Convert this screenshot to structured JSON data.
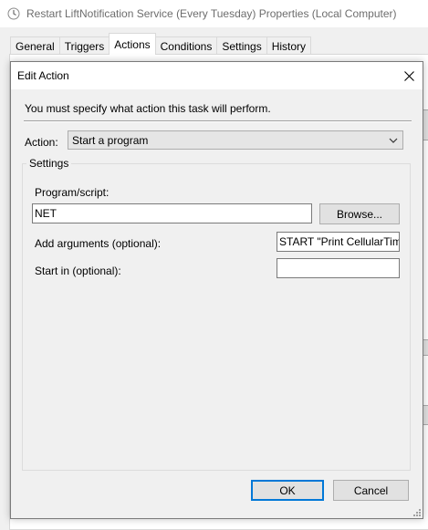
{
  "parent": {
    "title": "Restart LiftNotification Service (Every Tuesday) Properties (Local Computer)",
    "tabs": [
      {
        "label": "General"
      },
      {
        "label": "Triggers"
      },
      {
        "label": "Actions"
      },
      {
        "label": "Conditions"
      },
      {
        "label": "Settings"
      },
      {
        "label": "History"
      }
    ],
    "active_tab": "Actions"
  },
  "dialog": {
    "title": "Edit Action",
    "instruction": "You must specify what action this task will perform.",
    "action_label": "Action:",
    "action_value": "Start a program",
    "settings_group_label": "Settings",
    "program_label": "Program/script:",
    "program_value": "NET",
    "browse_label": "Browse...",
    "arguments_label": "Add arguments (optional):",
    "arguments_value": "START \"Print CellularTim",
    "start_in_label": "Start in (optional):",
    "start_in_value": "",
    "ok_label": "OK",
    "cancel_label": "Cancel"
  },
  "icons": {
    "app": "task-clock-icon",
    "close": "close-icon",
    "dropdown": "chevron-down-icon",
    "grip": "resize-grip-icon"
  },
  "colors": {
    "accent": "#0078d7",
    "window_bg": "#f0f0f0",
    "button_bg": "#e1e1e1"
  }
}
